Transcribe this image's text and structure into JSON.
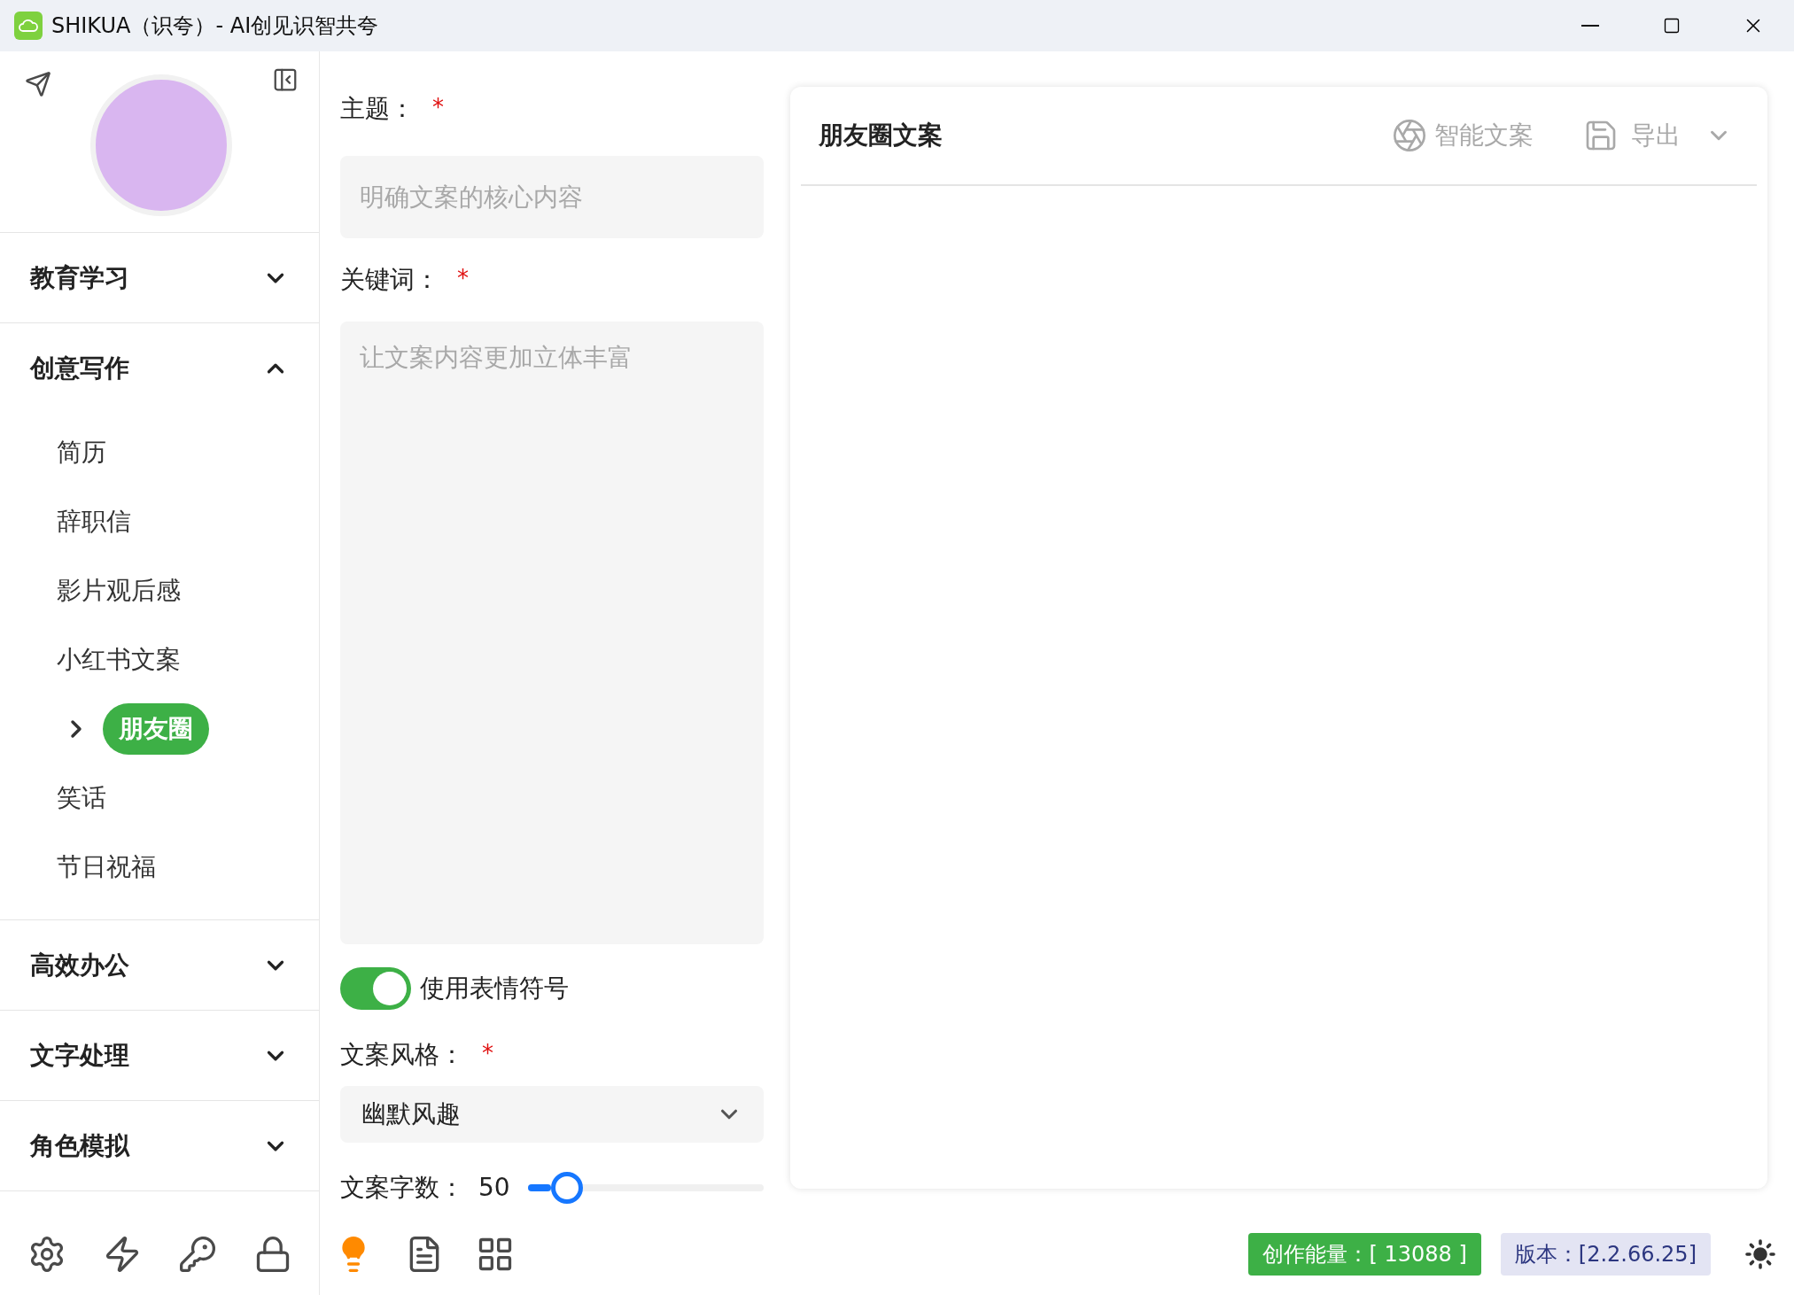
{
  "window": {
    "title": "SHIKUA（识夸）- AI创见识智共夸"
  },
  "sidebar": {
    "groups": [
      {
        "label": "教育学习",
        "expanded": false
      },
      {
        "label": "创意写作",
        "expanded": true,
        "children": [
          {
            "label": "简历",
            "selected": false
          },
          {
            "label": "辞职信",
            "selected": false
          },
          {
            "label": "影片观后感",
            "selected": false
          },
          {
            "label": "小红书文案",
            "selected": false
          },
          {
            "label": "朋友圈",
            "selected": true
          },
          {
            "label": "笑话",
            "selected": false
          },
          {
            "label": "节日祝福",
            "selected": false
          }
        ]
      },
      {
        "label": "高效办公",
        "expanded": false
      },
      {
        "label": "文字处理",
        "expanded": false
      },
      {
        "label": "角色模拟",
        "expanded": false
      }
    ]
  },
  "form": {
    "fields": [
      {
        "kind": "input",
        "label": "主题：",
        "required": true,
        "mark": "*",
        "placeholder": "明确文案的核心内容"
      },
      {
        "kind": "textarea",
        "label": "关键词：",
        "required": true,
        "mark": "*",
        "placeholder": "让文案内容更加立体丰富"
      },
      {
        "kind": "toggle",
        "label": "使用表情符号",
        "on": true
      },
      {
        "kind": "select",
        "label": "文案风格：",
        "required": true,
        "mark": "*",
        "value": "幽默风趣"
      },
      {
        "kind": "slider",
        "label": "文案字数：",
        "reading": "50",
        "level": 0.1
      }
    ]
  },
  "panel": {
    "title": "朋友圈文案",
    "actions": [
      {
        "kind": "ai",
        "label": "智能文案"
      },
      {
        "kind": "export",
        "label": "导出"
      }
    ]
  },
  "status_bar": {
    "energy": "创作能量：[ 13088 ]",
    "version": "版本：[2.2.66.25]"
  }
}
